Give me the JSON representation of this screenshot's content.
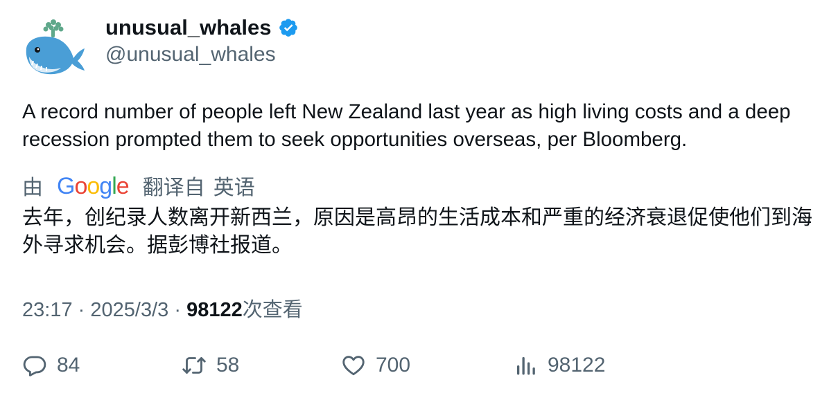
{
  "user": {
    "display_name": "unusual_whales",
    "handle": "@unusual_whales",
    "verified_color": "#1d9bf0",
    "avatar_icon": "whale-icon"
  },
  "tweet": {
    "text": "A record number of people left New Zealand last year as high living costs and a deep recession prompted them to seek opportunities overseas, per Bloomberg."
  },
  "translation": {
    "by": "由",
    "provider_logo": "Google",
    "from_label": "翻译自",
    "language": "英语",
    "text": "去年，创纪录人数离开新西兰，原因是高昂的生活成本和严重的经济衰退促使他们到海外寻求机会。据彭博社报道。"
  },
  "meta": {
    "time": "23:17",
    "separator": "·",
    "date": "2025/3/3",
    "views_count": "98122",
    "views_label": "次查看"
  },
  "actions": {
    "replies": "84",
    "retweets": "58",
    "likes": "700",
    "views": "98122"
  }
}
